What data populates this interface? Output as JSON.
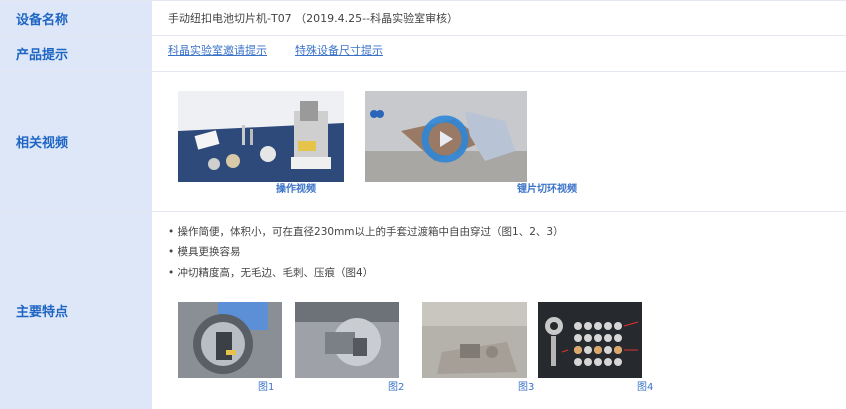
{
  "rows": {
    "device_name": {
      "label": "设备名称",
      "value": "手动纽扣电池切片机-T07 （2019.4.25--科晶实验室审核）"
    },
    "product_tips": {
      "label": "产品提示",
      "links": [
        "科晶实验室邀请提示",
        "特殊设备尺寸提示"
      ]
    },
    "videos": {
      "label": "相关视频",
      "items": [
        {
          "caption": "操作视频"
        },
        {
          "caption": "锂片切环视频"
        }
      ]
    },
    "features": {
      "label": "主要特点",
      "bullets": [
        "• 操作简便，体积小，可在直径230mm以上的手套过渡箱中自由穿过（图1、2、3）",
        "• 模具更换容易",
        "• 冲切精度高，无毛边、毛刺、压痕（图4）"
      ],
      "figures": [
        "图1",
        "图2",
        "图3",
        "图4"
      ]
    }
  },
  "colors": {
    "label_bg": "#dde7f7",
    "label_text": "#1f66c4",
    "link": "#3a72c8",
    "border": "#e4e9ef"
  }
}
